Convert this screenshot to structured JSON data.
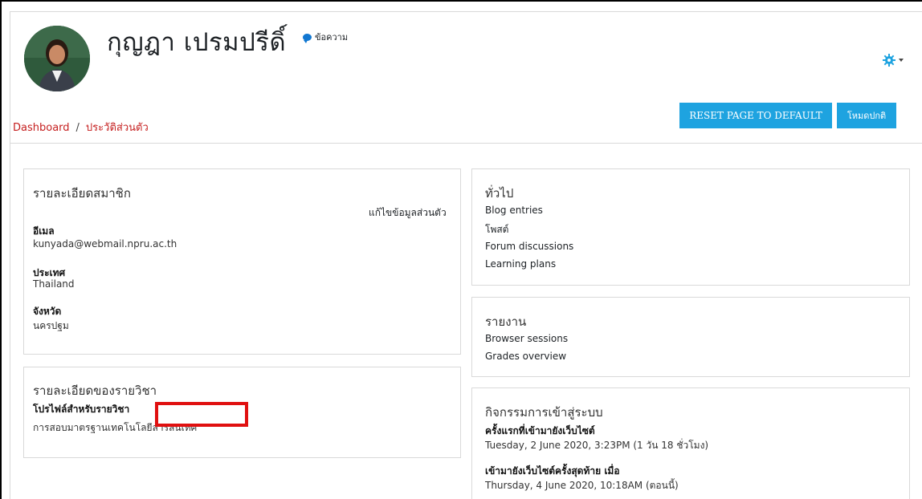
{
  "header": {
    "user_name": "กุญฎา เปรมปรีดิ์",
    "message_label": "ข้อความ",
    "breadcrumb": [
      "Dashboard",
      "ประวัติส่วนตัว"
    ],
    "reset_button": "RESET PAGE TO DEFAULT",
    "mode_button": "โหมดปกติ",
    "settings_icon": "gear-icon"
  },
  "user_details": {
    "title": "รายละเอียดสมาชิก",
    "edit_link": "แก้ไขข้อมูลส่วนตัว",
    "email_label": "อีเมล",
    "email_value": "kunyada@webmail.npru.ac.th",
    "country_label": "ประเทศ",
    "country_value": "Thailand",
    "city_label": "จังหวัด",
    "city_value": "นครปฐม"
  },
  "course_details": {
    "title": "รายละเอียดของรายวิชา",
    "profile_label": "โปรไฟล์สำหรับรายวิชา",
    "profile_value": "การสอบมาตรฐานเทคโนโลยีสารสนเทศ"
  },
  "general": {
    "title": "ทั่วไป",
    "links": [
      "Blog entries",
      "โพสต์",
      "Forum discussions",
      "Learning plans"
    ]
  },
  "reports": {
    "title": "รายงาน",
    "links": [
      "Browser sessions",
      "Grades overview"
    ]
  },
  "login_activity": {
    "title": "กิจกรรมการเข้าสู่ระบบ",
    "first_label": "ครั้งแรกที่เข้ามายังเว็บไซต์",
    "first_value": "Tuesday, 2 June 2020, 3:23PM  (1 วัน 18 ชั่วโมง)",
    "last_label": "เข้ามายังเว็บไซต์ครั้งสุดท้าย เมื่อ",
    "last_value": "Thursday, 4 June 2020, 10:18AM  (ตอนนี้)"
  },
  "colors": {
    "accent": "#1ea3e0",
    "breadcrumb": "#c51e1e",
    "highlight_box": "#e01010"
  }
}
